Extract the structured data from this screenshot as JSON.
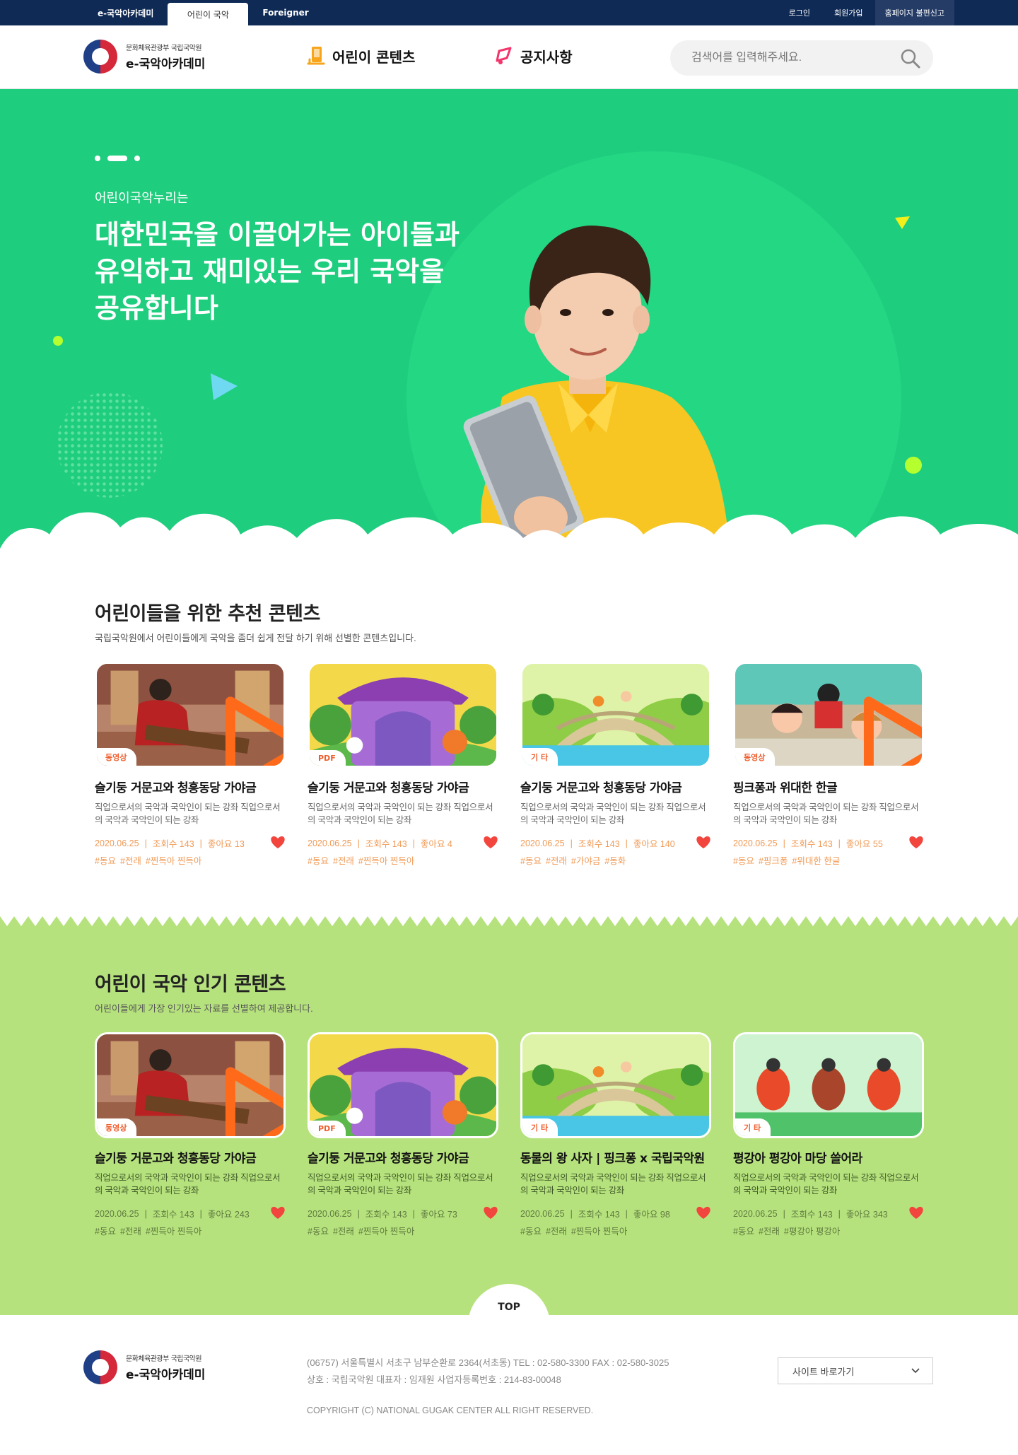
{
  "topbar": {
    "tabs": [
      "e-국악아카데미",
      "어린이 국악",
      "Foreigner"
    ],
    "links": [
      "로그인",
      "회원가입",
      "홈페이지 불편신고"
    ]
  },
  "header": {
    "logo_sub": "문화체육관광부 국립국악원",
    "logo_main": "e-국악아카데미",
    "nav": [
      "어린이 콘텐츠",
      "공지사항"
    ],
    "search_placeholder": "검색어를 입력해주세요."
  },
  "hero": {
    "subtitle": "어린이국악누리는",
    "title_lines": [
      "대한민국을 이끌어가는 아이들과",
      "유익하고 재미있는 우리 국악을",
      "공유합니다"
    ]
  },
  "recommended": {
    "title_plain": "어린이들을 위한 ",
    "title_highlight": "추천 콘텐츠",
    "description": "국립국악원에서 어린이들에게 국악을 좀더 쉽게 전달 하기 위해 선별한 콘텐츠입니다.",
    "cards": [
      {
        "badge": "동영상",
        "title": "슬기둥 거문고와 청흥동당 가야금",
        "desc": "직업으로서의 국악과 국악인이 되는 강좌 직업으로서의 국악과 국악인이 되는 강좌",
        "date": "2020.06.25",
        "views": "조회수 143",
        "likes": "좋아요 13",
        "tags": [
          "#동요",
          "#전래",
          "#찐득아 찐득아"
        ]
      },
      {
        "badge": "PDF",
        "title": "슬기둥 거문고와 청흥동당 가야금",
        "desc": "직업으로서의 국악과 국악인이 되는 강좌 직업으로서의 국악과 국악인이 되는 강좌",
        "date": "2020.06.25",
        "views": "조회수 143",
        "likes": "좋아요 4",
        "tags": [
          "#동요",
          "#전래",
          "#찐득아 찐득아"
        ]
      },
      {
        "badge": "기 타",
        "title": "슬기둥 거문고와 청흥동당 가야금",
        "desc": "직업으로서의 국악과 국악인이 되는 강좌 직업으로서의 국악과 국악인이 되는 강좌",
        "date": "2020.06.25",
        "views": "조회수 143",
        "likes": "좋아요 140",
        "tags": [
          "#동요",
          "#전래",
          "#가야금",
          "#동화"
        ]
      },
      {
        "badge": "동영상",
        "title": "핑크퐁과 위대한 한글",
        "desc": "직업으로서의 국악과 국악인이 되는 강좌 직업으로서의 국악과 국악인이 되는 강좌",
        "date": "2020.06.25",
        "views": "조회수 143",
        "likes": "좋아요 55",
        "tags": [
          "#동요",
          "#핑크퐁",
          "#위대한 한글"
        ]
      }
    ]
  },
  "popular": {
    "title_plain": "어린이 국악 ",
    "title_highlight": "인기 콘텐츠",
    "description": "어린이들에게 가장 인기있는 자료를 선별하여 제공합니다.",
    "cards": [
      {
        "badge": "동영상",
        "title": "슬기둥 거문고와 청흥동당 가야금",
        "desc": "직업으로서의 국악과 국악인이 되는 강좌 직업으로서의 국악과 국악인이 되는 강좌",
        "date": "2020.06.25",
        "views": "조회수 143",
        "likes": "좋아요 243",
        "tags": [
          "#동요",
          "#전래",
          "#찐득아 찐득아"
        ]
      },
      {
        "badge": "PDF",
        "title": "슬기둥 거문고와 청흥동당 가야금",
        "desc": "직업으로서의 국악과 국악인이 되는 강좌 직업으로서의 국악과 국악인이 되는 강좌",
        "date": "2020.06.25",
        "views": "조회수 143",
        "likes": "좋아요 73",
        "tags": [
          "#동요",
          "#전래",
          "#찐득아 찐득아"
        ]
      },
      {
        "badge": "기 타",
        "title": "동물의 왕 사자 | 핑크퐁 x 국립국악원",
        "desc": "직업으로서의 국악과 국악인이 되는 강좌 직업으로서의 국악과 국악인이 되는 강좌",
        "date": "2020.06.25",
        "views": "조회수 143",
        "likes": "좋아요 98",
        "tags": [
          "#동요",
          "#전래",
          "#찐득아 찐득아"
        ]
      },
      {
        "badge": "기 타",
        "title": "평강아 평강아 마당 쓸어라",
        "desc": "직업으로서의 국악과 국악인이 되는 강좌 직업으로서의 국악과 국악인이 되는 강좌",
        "date": "2020.06.25",
        "views": "조회수 143",
        "likes": "좋아요 343",
        "tags": [
          "#동요",
          "#전래",
          "#평강아 평강아"
        ]
      }
    ]
  },
  "top_button": "TOP",
  "footer": {
    "logo_sub": "문화체육관광부 국립국악원",
    "logo_main": "e-국악아카데미",
    "address": "(06757) 서울특별시 서초구 남부순환로 2364(서초동)   TEL : 02-580-3300   FAX : 02-580-3025",
    "company": "상호 : 국립국악원   대표자 : 임재원   사업자등록번호 : 214-83-00048",
    "copyright": "COPYRIGHT (C) NATIONAL GUGAK CENTER ALL RIGHT RESERVED.",
    "site_select": "사이트 바로가기"
  },
  "colors": {
    "topbar": "#0e2a55",
    "hero_green": "#1fcd7e",
    "popular_bg": "#b6e27e",
    "highlight_cyan": "#34e0ee",
    "highlight_green": "#3ad27a",
    "accent_orange": "#ef5e2d",
    "heart": "#f2453d"
  },
  "icons": [
    "search-icon",
    "contents-icon",
    "notice-icon",
    "play-icon",
    "heart-icon",
    "chevron-down-icon"
  ]
}
